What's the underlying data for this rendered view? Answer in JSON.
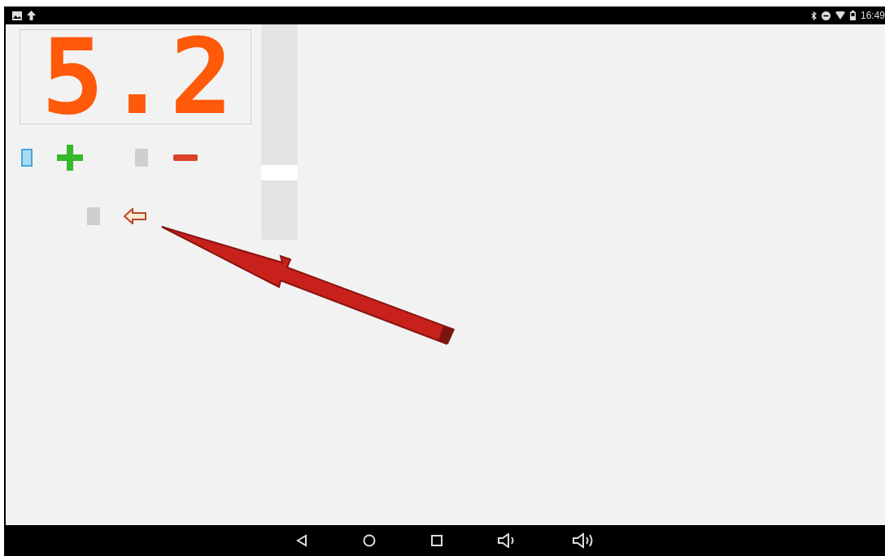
{
  "status_bar": {
    "time": "16:49"
  },
  "display": {
    "value": "5.2"
  }
}
